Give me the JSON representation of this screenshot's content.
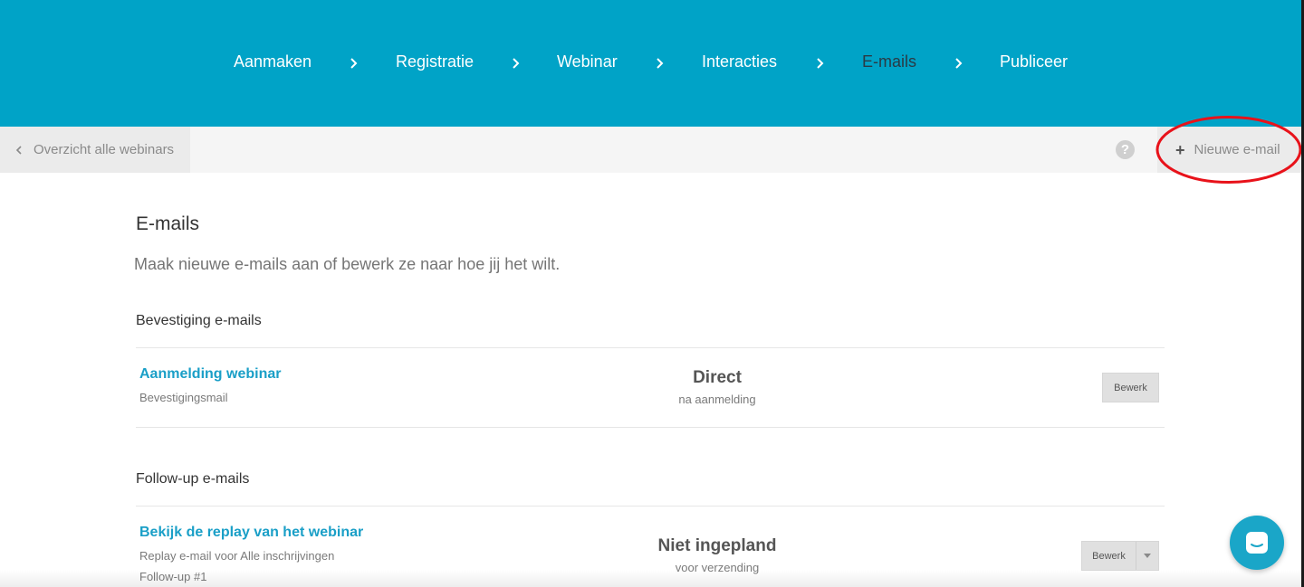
{
  "wizard": {
    "steps": [
      {
        "label": "Aanmaken"
      },
      {
        "label": "Registratie"
      },
      {
        "label": "Webinar"
      },
      {
        "label": "Interacties"
      },
      {
        "label": "E-mails",
        "active": true
      },
      {
        "label": "Publiceer"
      }
    ]
  },
  "subbar": {
    "back_label": "Overzicht alle webinars",
    "help_label": "?",
    "new_email_label": "Nieuwe e-mail"
  },
  "page": {
    "title": "E-mails",
    "subtitle": "Maak nieuwe e-mails aan of bewerk ze naar hoe jij het wilt."
  },
  "confirmation_section": {
    "title": "Bevestiging e-mails",
    "rows": [
      {
        "title": "Aanmelding webinar",
        "subtitle": "Bevestigingsmail",
        "timing": "Direct",
        "timing_sub": "na aanmelding",
        "edit_label": "Bewerk"
      }
    ]
  },
  "followup_section": {
    "title": "Follow-up e-mails",
    "rows": [
      {
        "title": "Bekijk de replay van het webinar",
        "subtitle": "Replay e-mail voor Alle inschrijvingen",
        "subtitle2": "Follow-up #1",
        "timing": "Niet ingepland",
        "timing_sub": "voor verzending",
        "edit_label": "Bewerk"
      }
    ]
  },
  "colors": {
    "brand": "#00a3c7",
    "link": "#1a9fc7",
    "annotation": "#e8121a"
  },
  "icons": [
    "chevron-right-icon",
    "chevron-left-icon",
    "help-icon",
    "plus-icon",
    "caret-down-icon",
    "chat-icon"
  ]
}
